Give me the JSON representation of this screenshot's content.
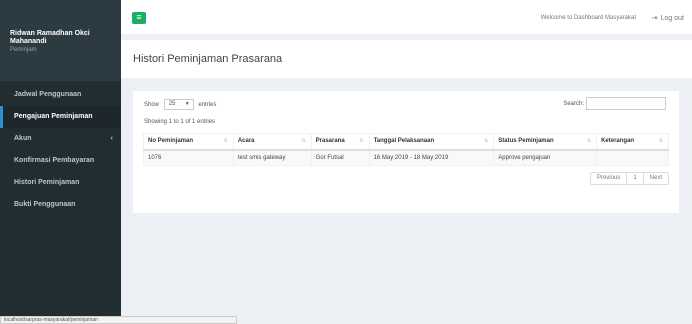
{
  "sidebar": {
    "user_name": "Ridwan Ramadhan Okci Mahanandi",
    "user_role": "Peminjam",
    "items": [
      {
        "label": "Jadwal Penggunaan"
      },
      {
        "label": "Pengajuan Peminjaman"
      },
      {
        "label": "Akun"
      },
      {
        "label": "Konfirmasi Pembayaran"
      },
      {
        "label": "Histori Peminjaman"
      },
      {
        "label": "Bukti Penggunaan"
      }
    ],
    "akun_chevron": "‹"
  },
  "topbar": {
    "toggle_glyph": "≡",
    "welcome": "Welcome to Dashboard Masyarakat",
    "logout_icon": "⇥",
    "logout_label": "Log out"
  },
  "header": {
    "title": "Histori Peminjaman Prasarana"
  },
  "table_controls": {
    "show_label": "Show",
    "entries_value": "25",
    "entries_label": "entries",
    "search_label": "Search:",
    "search_value": "",
    "info": "Showing 1 to 1 of 1 entries"
  },
  "table": {
    "columns": [
      "No Peminjaman",
      "Acara",
      "Prasarana",
      "Tanggal Pelaksanaan",
      "Status Peminjaman",
      "Keterangan"
    ],
    "rows": [
      [
        "1076",
        "test smis gateway",
        "Gor Futsal",
        "16 May 2019 - 18 May 2019",
        "Approve pengajuan",
        ""
      ]
    ]
  },
  "pagination": {
    "previous": "Previous",
    "current": "1",
    "next": "Next"
  },
  "statusbar": {
    "url": "localhost/sarpras-masyarakat/peminjaman"
  },
  "colors": {
    "sidebar_bg": "#222d32",
    "accent_green": "#1aae64",
    "link_blue": "#3c8dbc",
    "content_bg": "#ecf0f5"
  }
}
